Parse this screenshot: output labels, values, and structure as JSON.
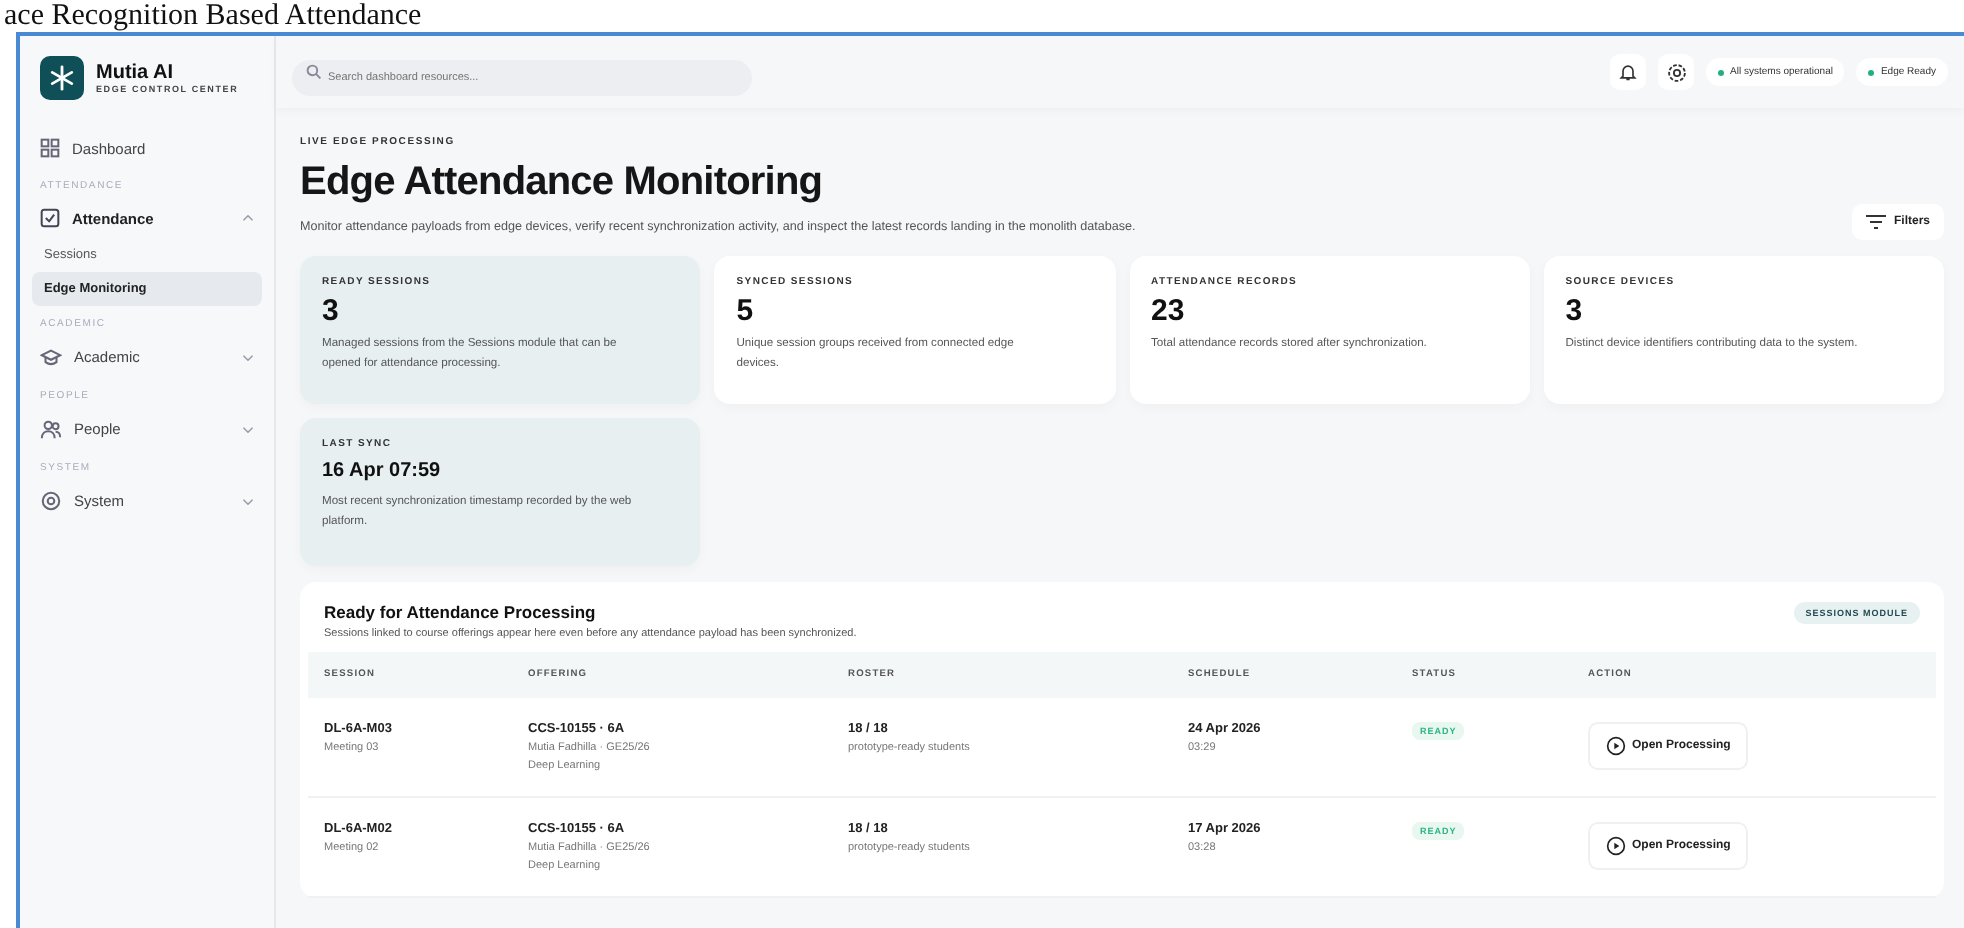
{
  "document_heading": "ace Recognition Based Attendance",
  "sidebar": {
    "brand": {
      "name": "Mutia AI",
      "subtitle": "EDGE CONTROL CENTER"
    },
    "nav": [
      {
        "kind": "link",
        "label": "Dashboard"
      },
      {
        "kind": "section",
        "label": "ATTENDANCE"
      },
      {
        "kind": "group",
        "label": "Attendance",
        "expanded": true,
        "children": [
          {
            "label": "Sessions",
            "selected": false
          },
          {
            "label": "Edge Monitoring",
            "selected": true
          }
        ]
      },
      {
        "kind": "section",
        "label": "ACADEMIC"
      },
      {
        "kind": "group",
        "label": "Academic",
        "expanded": false
      },
      {
        "kind": "section",
        "label": "PEOPLE"
      },
      {
        "kind": "group",
        "label": "People",
        "expanded": false
      },
      {
        "kind": "section",
        "label": "SYSTEM"
      },
      {
        "kind": "group",
        "label": "System",
        "expanded": false
      }
    ]
  },
  "header": {
    "search": {
      "placeholder": "Search dashboard resources..."
    },
    "status_pills": [
      {
        "label": "All systems operational",
        "color": "#22b07d"
      },
      {
        "label": "Edge Ready",
        "color": "#22b07d"
      }
    ]
  },
  "page": {
    "eyebrow": "LIVE EDGE PROCESSING",
    "title": "Edge Attendance Monitoring",
    "description": "Monitor attendance payloads from edge devices, verify recent synchronization activity, and inspect the latest records landing in the monolith database.",
    "filters_button": "Filters"
  },
  "stats": [
    {
      "label": "READY SESSIONS",
      "value": "3",
      "description": "Managed sessions from the Sessions module that can be opened for attendance processing.",
      "highlighted": true
    },
    {
      "label": "SYNCED SESSIONS",
      "value": "5",
      "description": "Unique session groups received from connected edge devices.",
      "highlighted": false
    },
    {
      "label": "ATTENDANCE RECORDS",
      "value": "23",
      "description": "Total attendance records stored after synchronization.",
      "highlighted": false
    },
    {
      "label": "SOURCE DEVICES",
      "value": "3",
      "description": "Distinct device identifiers contributing data to the system.",
      "highlighted": false
    },
    {
      "label": "LAST SYNC",
      "value": "16 Apr 07:59",
      "description": "Most recent synchronization timestamp recorded by the web platform.",
      "highlighted": true
    }
  ],
  "table": {
    "title": "Ready for Attendance Processing",
    "subtitle": "Sessions linked to course offerings appear here even before any attendance payload has been synchronized.",
    "badge": "SESSIONS MODULE",
    "columns": [
      "SESSION",
      "OFFERING",
      "ROSTER",
      "SCHEDULE",
      "STATUS",
      "ACTION"
    ],
    "rows": [
      {
        "session": "DL-6A-M03",
        "meeting": "Meeting 03",
        "offering": "CCS-10155 · 6A",
        "lecturer": "Mutia Fadhilla · GE25/26",
        "course": "Deep Learning",
        "roster": "18 / 18",
        "roster_note": "prototype-ready students",
        "date": "24 Apr 2026",
        "time": "03:29",
        "status": "READY",
        "action": "Open Processing"
      },
      {
        "session": "DL-6A-M02",
        "meeting": "Meeting 02",
        "offering": "CCS-10155 · 6A",
        "lecturer": "Mutia Fadhilla · GE25/26",
        "course": "Deep Learning",
        "roster": "18 / 18",
        "roster_note": "prototype-ready students",
        "date": "17 Apr 2026",
        "time": "03:28",
        "status": "READY",
        "action": "Open Processing"
      }
    ]
  }
}
